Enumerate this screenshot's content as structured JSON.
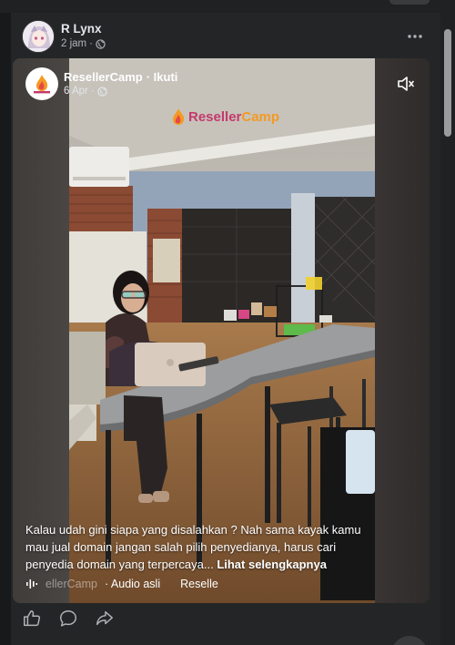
{
  "post": {
    "author": "R Lynx",
    "time": "2 jam",
    "privacy_icon": "globe-icon"
  },
  "shared": {
    "page_name": "ResellerCamp",
    "follow_label": "· Ikuti",
    "date": "6 Apr",
    "watermark_a": "Reseller",
    "watermark_b": "Camp",
    "caption": "Kalau udah gini siapa yang disalahkan ? Nah sama kayak kamu mau jual domain jangan salah pilih penyedianya, harus cari penyedia domain yang terpercaya...",
    "see_more": "Lihat selengkapnya",
    "audio_owner": "ellerCamp",
    "audio_label": "· Audio asli",
    "audio_scroll": "Reselle"
  },
  "colors": {
    "background": "#18191a",
    "card": "#242526",
    "accent_orange": "#f39a23"
  }
}
